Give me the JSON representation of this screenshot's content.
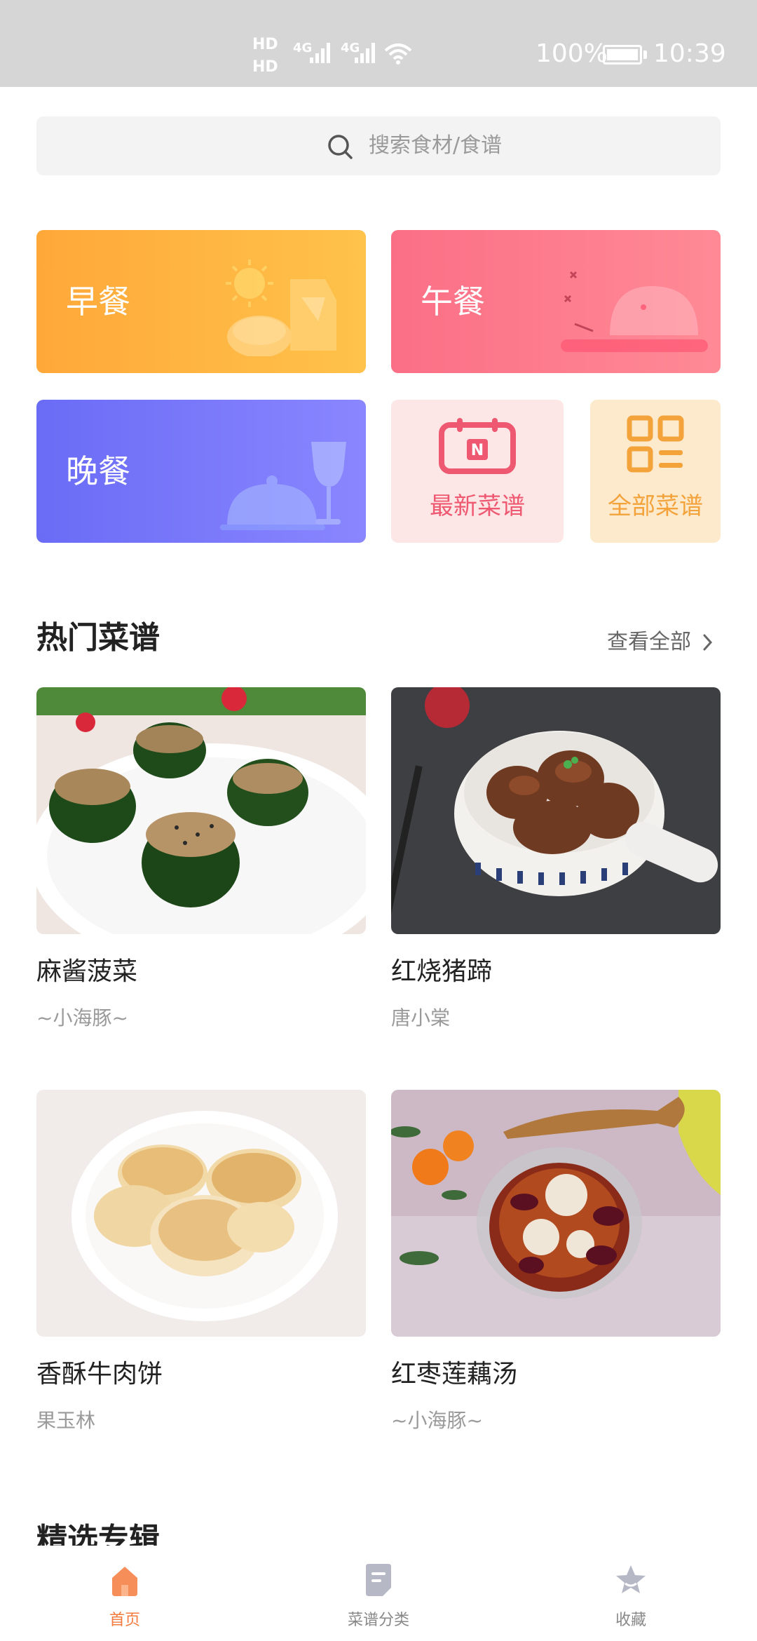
{
  "status_bar": {
    "hd1": "HD",
    "hd2": "HD",
    "net1": "4G",
    "net2": "4G",
    "battery_pct": "100%",
    "time": "10:39"
  },
  "search": {
    "placeholder": "搜索食材/食谱"
  },
  "categories": [
    {
      "label": "早餐"
    },
    {
      "label": "午餐"
    },
    {
      "label": "晚餐"
    },
    {
      "label": "最新菜谱"
    },
    {
      "label": "全部菜谱"
    }
  ],
  "hot_section": {
    "title": "热门菜谱",
    "see_all": "查看全部"
  },
  "recipes": [
    {
      "name": "麻酱菠菜",
      "author": "~小海豚~"
    },
    {
      "name": "红烧猪蹄",
      "author": "唐小棠"
    },
    {
      "name": "香酥牛肉饼",
      "author": "果玉林"
    },
    {
      "name": "红枣莲藕汤",
      "author": "~小海豚~"
    }
  ],
  "featured_section": {
    "title": "精选专辑"
  },
  "bottom_nav": [
    {
      "label": "首页",
      "icon": "home-icon",
      "active": true
    },
    {
      "label": "菜谱分类",
      "icon": "category-icon",
      "active": false
    },
    {
      "label": "收藏",
      "icon": "star-icon",
      "active": false
    }
  ],
  "colors": {
    "accent": "#f47a3c",
    "breakfast": "#ffa83a",
    "lunch": "#fb6f86",
    "dinner": "#6a6cf6",
    "new_recipes": "#ee5870",
    "all_recipes": "#f4a23a"
  }
}
